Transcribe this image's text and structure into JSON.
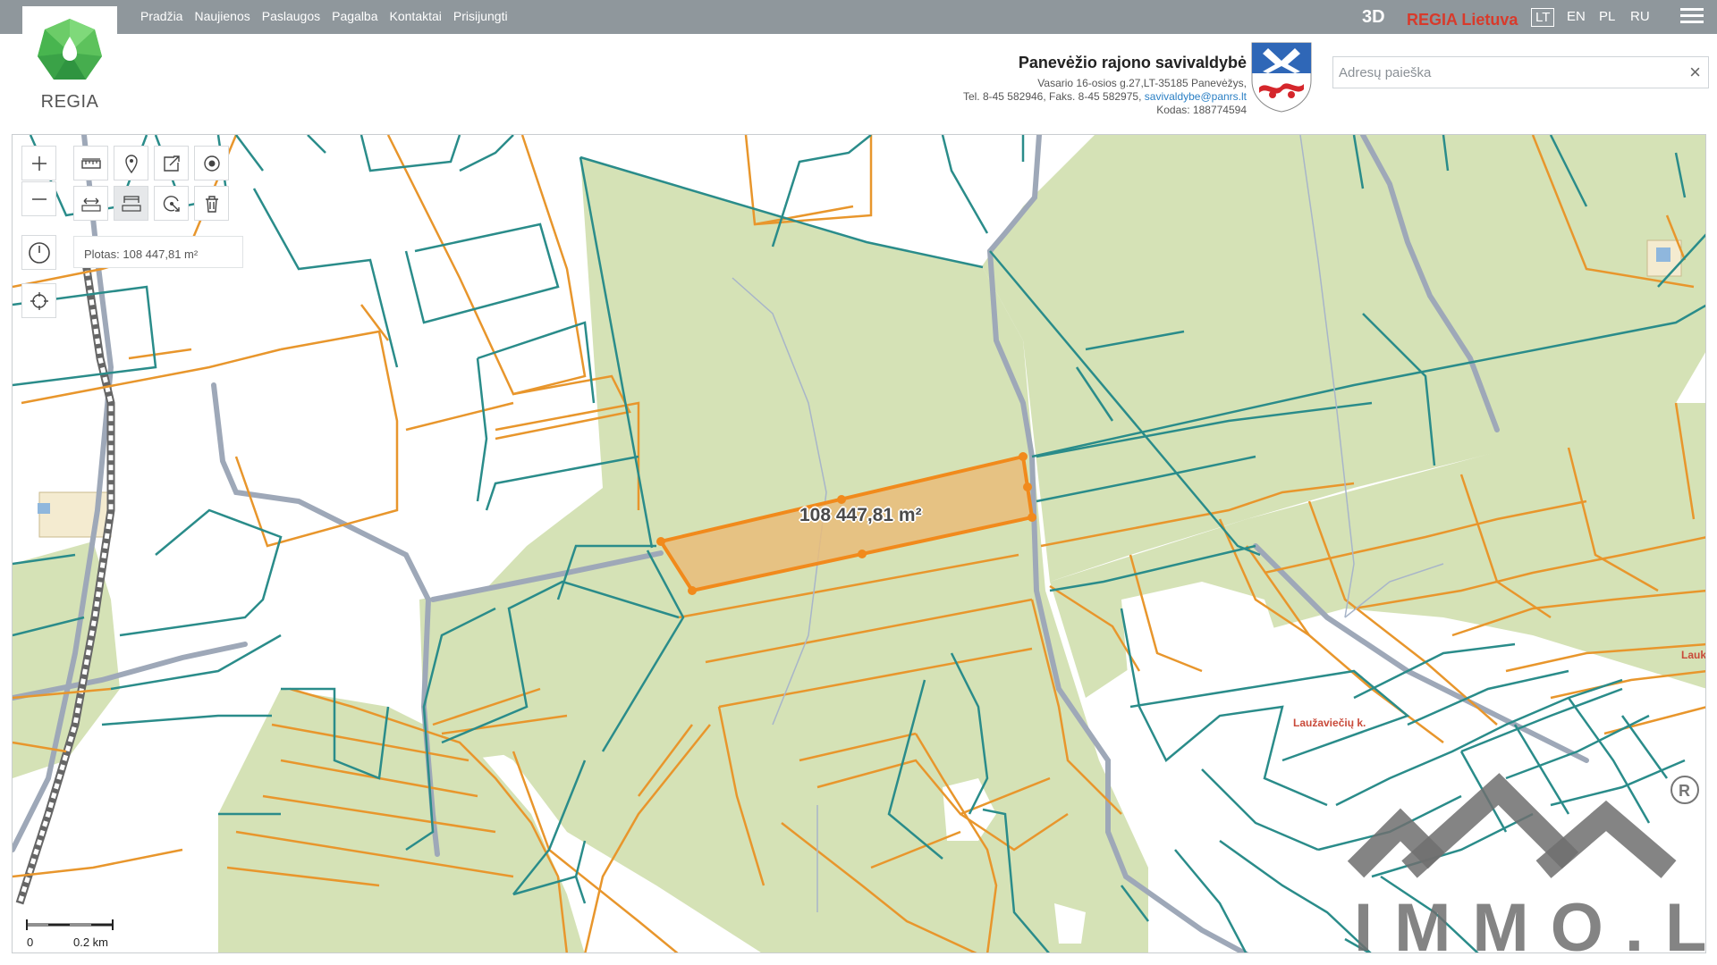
{
  "logo": {
    "text": "REGIA"
  },
  "nav": [
    "Pradžia",
    "Naujienos",
    "Paslaugos",
    "Pagalba",
    "Kontaktai",
    "Prisijungti"
  ],
  "header_right": {
    "btn_3d": "3D",
    "regia_lietuva": "REGIA Lietuva",
    "languages": [
      "LT",
      "EN",
      "PL",
      "RU"
    ],
    "active_language": "LT"
  },
  "municipality": {
    "title": "Panevėžio rajono savivaldybė",
    "address": "Vasario 16-osios g.27,LT-35185 Panevėžys,",
    "phone_fax": "Tel. 8-45 582946, Faks. 8-45 582975,",
    "email": "savivaldybe@panrs.lt",
    "code": "Kodas: 188774594"
  },
  "search": {
    "placeholder": "Adresų paieška",
    "value": "",
    "clear_glyph": "×"
  },
  "map": {
    "area_readout": "Plotas: 108 447,81 m²",
    "area_label": "108 447,81 m²",
    "place_label": "Laužaviečių k.",
    "place_label_edge": "Lauk",
    "scale_zero": "0",
    "scale_distance": "0.2 km",
    "watermark": "IMMO.LT",
    "colors": {
      "forest": "#d5e2b6",
      "teal_boundary": "#2a8c8a",
      "orange_boundary": "#e8962c",
      "selection_fill": "#e9bc7a",
      "selection_stroke": "#f18a1c",
      "road": "#9ea8b8"
    },
    "tools": [
      {
        "name": "zoom-in",
        "icon": "plus-icon"
      },
      {
        "name": "zoom-out",
        "icon": "minus-icon"
      },
      {
        "name": "measure-area",
        "icon": "ruler-icon"
      },
      {
        "name": "place-marker",
        "icon": "marker-icon"
      },
      {
        "name": "export",
        "icon": "export-icon"
      },
      {
        "name": "point",
        "icon": "target-icon"
      },
      {
        "name": "measure-distance",
        "icon": "distance-icon"
      },
      {
        "name": "measure-polygon",
        "icon": "polygon-ruler-icon"
      },
      {
        "name": "radius",
        "icon": "radius-icon"
      },
      {
        "name": "delete",
        "icon": "trash-icon"
      },
      {
        "name": "history",
        "icon": "clock-icon"
      },
      {
        "name": "locate",
        "icon": "crosshair-icon"
      }
    ]
  }
}
